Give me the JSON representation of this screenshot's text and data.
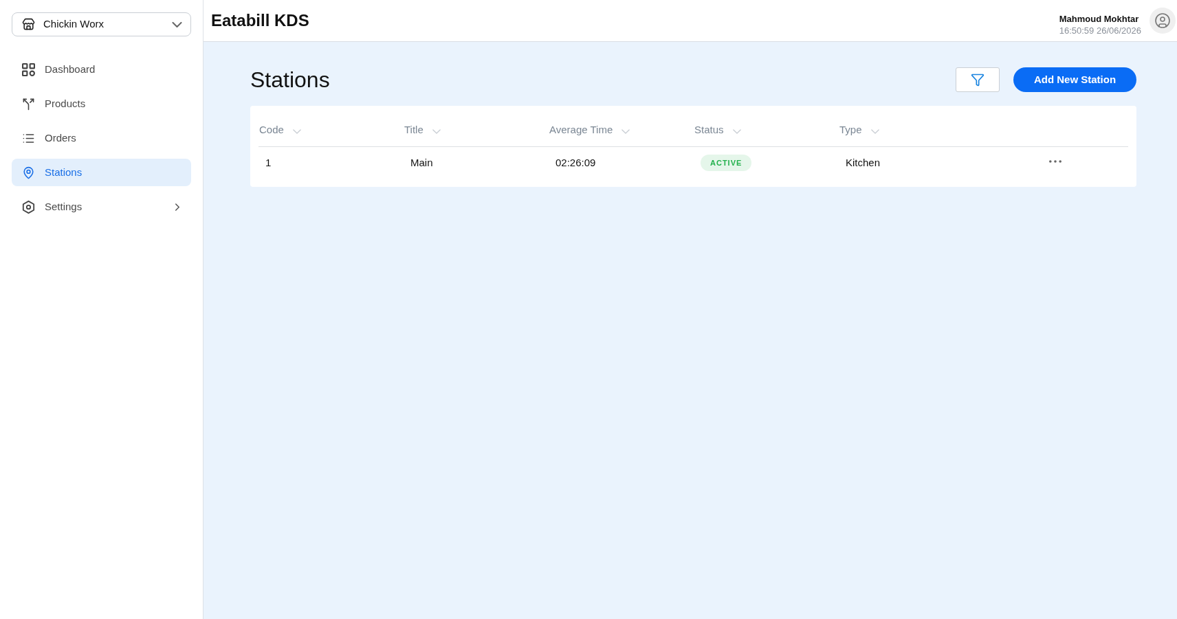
{
  "store_selector": {
    "value": "Chickin Worx"
  },
  "sidebar": {
    "items": [
      {
        "label": "Dashboard",
        "kind": "link",
        "selected": false
      },
      {
        "label": "Products",
        "kind": "link",
        "selected": false
      },
      {
        "label": "Orders",
        "kind": "link",
        "selected": false
      },
      {
        "label": "Stations",
        "kind": "link",
        "selected": true
      },
      {
        "label": "Settings",
        "kind": "group",
        "selected": false,
        "expanded": false
      }
    ]
  },
  "header": {
    "title": "Eatabill KDS",
    "user": {
      "name": "Mahmoud Mokhtar",
      "timestamp": "16:50:59 26/06/2026"
    }
  },
  "page": {
    "title": "Stations",
    "add_button": "Add New Station"
  },
  "table": {
    "columns": [
      {
        "label": "Code"
      },
      {
        "label": "Title"
      },
      {
        "label": "Average Time"
      },
      {
        "label": "Status"
      },
      {
        "label": "Type"
      }
    ],
    "rows": [
      {
        "code": "1",
        "title": "Main",
        "average_time": "02:26:09",
        "status": {
          "label": "ACTIVE",
          "kind": "active"
        },
        "type": "Kitchen"
      }
    ]
  }
}
